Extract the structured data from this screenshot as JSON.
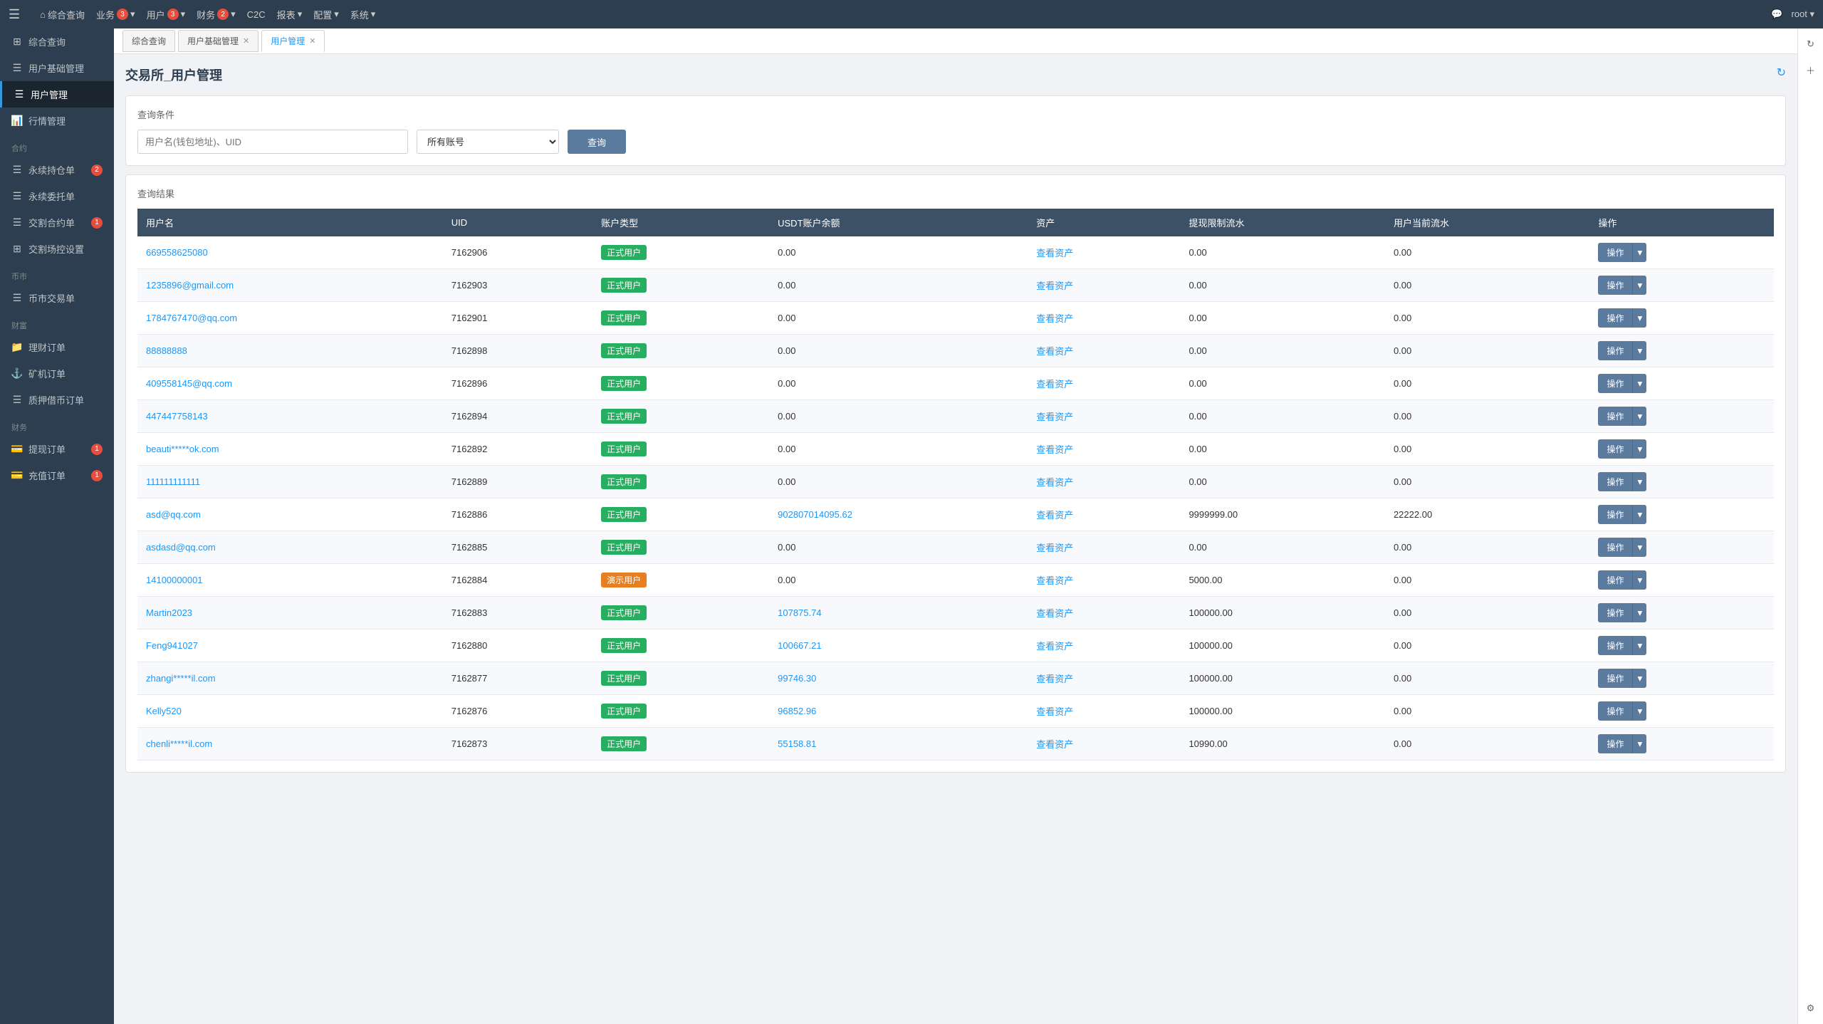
{
  "topNav": {
    "hamburger": "☰",
    "items": [
      {
        "label": "综合查询",
        "badge": null
      },
      {
        "label": "业务",
        "badge": "3"
      },
      {
        "label": "用户",
        "badge": "3"
      },
      {
        "label": "财务",
        "badge": "2"
      },
      {
        "label": "C2C",
        "badge": null
      },
      {
        "label": "报表",
        "badge": null
      },
      {
        "label": "配置",
        "badge": null
      },
      {
        "label": "系统",
        "badge": null
      }
    ],
    "user": "root"
  },
  "sidebar": {
    "sections": [
      {
        "title": "",
        "items": [
          {
            "icon": "⊞",
            "label": "综合查询",
            "badge": null,
            "active": false
          },
          {
            "icon": "☰",
            "label": "用户基础管理",
            "badge": null,
            "active": false
          },
          {
            "icon": "☰",
            "label": "用户管理",
            "badge": null,
            "active": true
          },
          {
            "icon": "📊",
            "label": "行情管理",
            "badge": null,
            "active": false
          }
        ]
      },
      {
        "title": "合约",
        "items": [
          {
            "icon": "☰",
            "label": "永续持仓单",
            "badge": "2",
            "active": false
          },
          {
            "icon": "☰",
            "label": "永续委托单",
            "badge": null,
            "active": false
          },
          {
            "icon": "☰",
            "label": "交割合约单",
            "badge": "1",
            "active": false
          },
          {
            "icon": "⊞",
            "label": "交割场控设置",
            "badge": null,
            "active": false
          }
        ]
      },
      {
        "title": "币市",
        "items": [
          {
            "icon": "☰",
            "label": "币市交易单",
            "badge": null,
            "active": false
          }
        ]
      },
      {
        "title": "财富",
        "items": [
          {
            "icon": "📁",
            "label": "理财订单",
            "badge": null,
            "active": false
          },
          {
            "icon": "⚓",
            "label": "矿机订单",
            "badge": null,
            "active": false
          },
          {
            "icon": "☰",
            "label": "质押借币订单",
            "badge": null,
            "active": false
          }
        ]
      },
      {
        "title": "财务",
        "items": [
          {
            "icon": "💳",
            "label": "提现订单",
            "badge": "1",
            "active": false
          },
          {
            "icon": "💳",
            "label": "充值订单",
            "badge": "1",
            "active": false
          }
        ]
      }
    ]
  },
  "tabs": [
    {
      "label": "综合查询",
      "closable": false,
      "active": false
    },
    {
      "label": "用户基础管理",
      "closable": true,
      "active": false
    },
    {
      "label": "用户管理",
      "closable": true,
      "active": true
    }
  ],
  "page": {
    "title": "交易所_用户管理",
    "searchSection": {
      "title": "查询条件",
      "inputPlaceholder": "用户名(钱包地址)、UID",
      "selectOptions": [
        "所有账号",
        "正式用户",
        "演示用户"
      ],
      "selectValue": "所有账号",
      "searchBtn": "查询"
    },
    "resultsSection": {
      "title": "查询结果",
      "columns": [
        "用户名",
        "UID",
        "账户类型",
        "USDT账户余额",
        "资产",
        "提现限制流水",
        "用户当前流水",
        "操作"
      ],
      "rows": [
        {
          "username": "669558625080",
          "uid": "7162906",
          "type": "正式用户",
          "typeClass": "normal",
          "usdt": "0.00",
          "asset": "查看资产",
          "withdrawLimit": "0.00",
          "currentFlow": "0.00"
        },
        {
          "username": "1235896@gmail.com",
          "uid": "7162903",
          "type": "正式用户",
          "typeClass": "normal",
          "usdt": "0.00",
          "asset": "查看资产",
          "withdrawLimit": "0.00",
          "currentFlow": "0.00"
        },
        {
          "username": "1784767470@qq.com",
          "uid": "7162901",
          "type": "正式用户",
          "typeClass": "normal",
          "usdt": "0.00",
          "asset": "查看资产",
          "withdrawLimit": "0.00",
          "currentFlow": "0.00"
        },
        {
          "username": "88888888",
          "uid": "7162898",
          "type": "正式用户",
          "typeClass": "normal",
          "usdt": "0.00",
          "asset": "查看资产",
          "withdrawLimit": "0.00",
          "currentFlow": "0.00"
        },
        {
          "username": "409558145@qq.com",
          "uid": "7162896",
          "type": "正式用户",
          "typeClass": "normal",
          "usdt": "0.00",
          "asset": "查看资产",
          "withdrawLimit": "0.00",
          "currentFlow": "0.00"
        },
        {
          "username": "447447758143",
          "uid": "7162894",
          "type": "正式用户",
          "typeClass": "normal",
          "usdt": "0.00",
          "asset": "查看资产",
          "withdrawLimit": "0.00",
          "currentFlow": "0.00"
        },
        {
          "username": "beauti*****ok.com",
          "uid": "7162892",
          "type": "正式用户",
          "typeClass": "normal",
          "usdt": "0.00",
          "asset": "查看资产",
          "withdrawLimit": "0.00",
          "currentFlow": "0.00"
        },
        {
          "username": "111111111111",
          "uid": "7162889",
          "type": "正式用户",
          "typeClass": "normal",
          "usdt": "0.00",
          "asset": "查看资产",
          "withdrawLimit": "0.00",
          "currentFlow": "0.00"
        },
        {
          "username": "asd@qq.com",
          "uid": "7162886",
          "type": "正式用户",
          "typeClass": "normal",
          "usdt": "902807014095.62",
          "asset": "查看资产",
          "withdrawLimit": "9999999.00",
          "currentFlow": "22222.00"
        },
        {
          "username": "asdasd@qq.com",
          "uid": "7162885",
          "type": "正式用户",
          "typeClass": "normal",
          "usdt": "0.00",
          "asset": "查看资产",
          "withdrawLimit": "0.00",
          "currentFlow": "0.00"
        },
        {
          "username": "14100000001",
          "uid": "7162884",
          "type": "演示用户",
          "typeClass": "demo",
          "usdt": "0.00",
          "asset": "查看资产",
          "withdrawLimit": "5000.00",
          "currentFlow": "0.00"
        },
        {
          "username": "Martin2023",
          "uid": "7162883",
          "type": "正式用户",
          "typeClass": "normal",
          "usdt": "107875.74",
          "asset": "查看资产",
          "withdrawLimit": "100000.00",
          "currentFlow": "0.00"
        },
        {
          "username": "Feng941027",
          "uid": "7162880",
          "type": "正式用户",
          "typeClass": "normal",
          "usdt": "100667.21",
          "asset": "查看资产",
          "withdrawLimit": "100000.00",
          "currentFlow": "0.00"
        },
        {
          "username": "zhangi*****il.com",
          "uid": "7162877",
          "type": "正式用户",
          "typeClass": "normal",
          "usdt": "99746.30",
          "asset": "查看资产",
          "withdrawLimit": "100000.00",
          "currentFlow": "0.00"
        },
        {
          "username": "Kelly520",
          "uid": "7162876",
          "type": "正式用户",
          "typeClass": "normal",
          "usdt": "96852.96",
          "asset": "查看资产",
          "withdrawLimit": "100000.00",
          "currentFlow": "0.00"
        },
        {
          "username": "chenli*****il.com",
          "uid": "7162873",
          "type": "正式用户",
          "typeClass": "normal",
          "usdt": "55158.81",
          "asset": "查看资产",
          "withdrawLimit": "10990.00",
          "currentFlow": "0.00"
        }
      ],
      "actionBtn": "操作"
    }
  }
}
